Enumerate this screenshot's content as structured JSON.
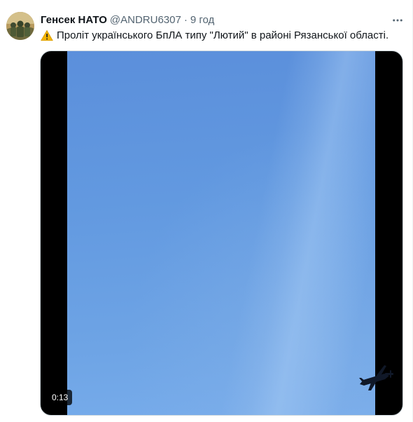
{
  "tweet": {
    "author": {
      "display_name": "Генсек НАТО",
      "handle": "@ANDRU6307",
      "separator": "·",
      "time": "9 год",
      "avatar_icon": "soldiers-group-avatar"
    },
    "text": {
      "emoji_icon": "warning-icon",
      "body": "Проліт українського БпЛА типу \"Лютий\" в районі Рязанської області."
    },
    "more_icon": "more-horizontal-icon",
    "media": {
      "type": "video",
      "duration": "0:13",
      "content_icon": "drone-icon"
    }
  },
  "colors": {
    "text_primary": "#0f1419",
    "text_secondary": "#536471",
    "media_border": "#cfd9de",
    "sky_blue": "#6299e0",
    "letterbox": "#000000"
  }
}
